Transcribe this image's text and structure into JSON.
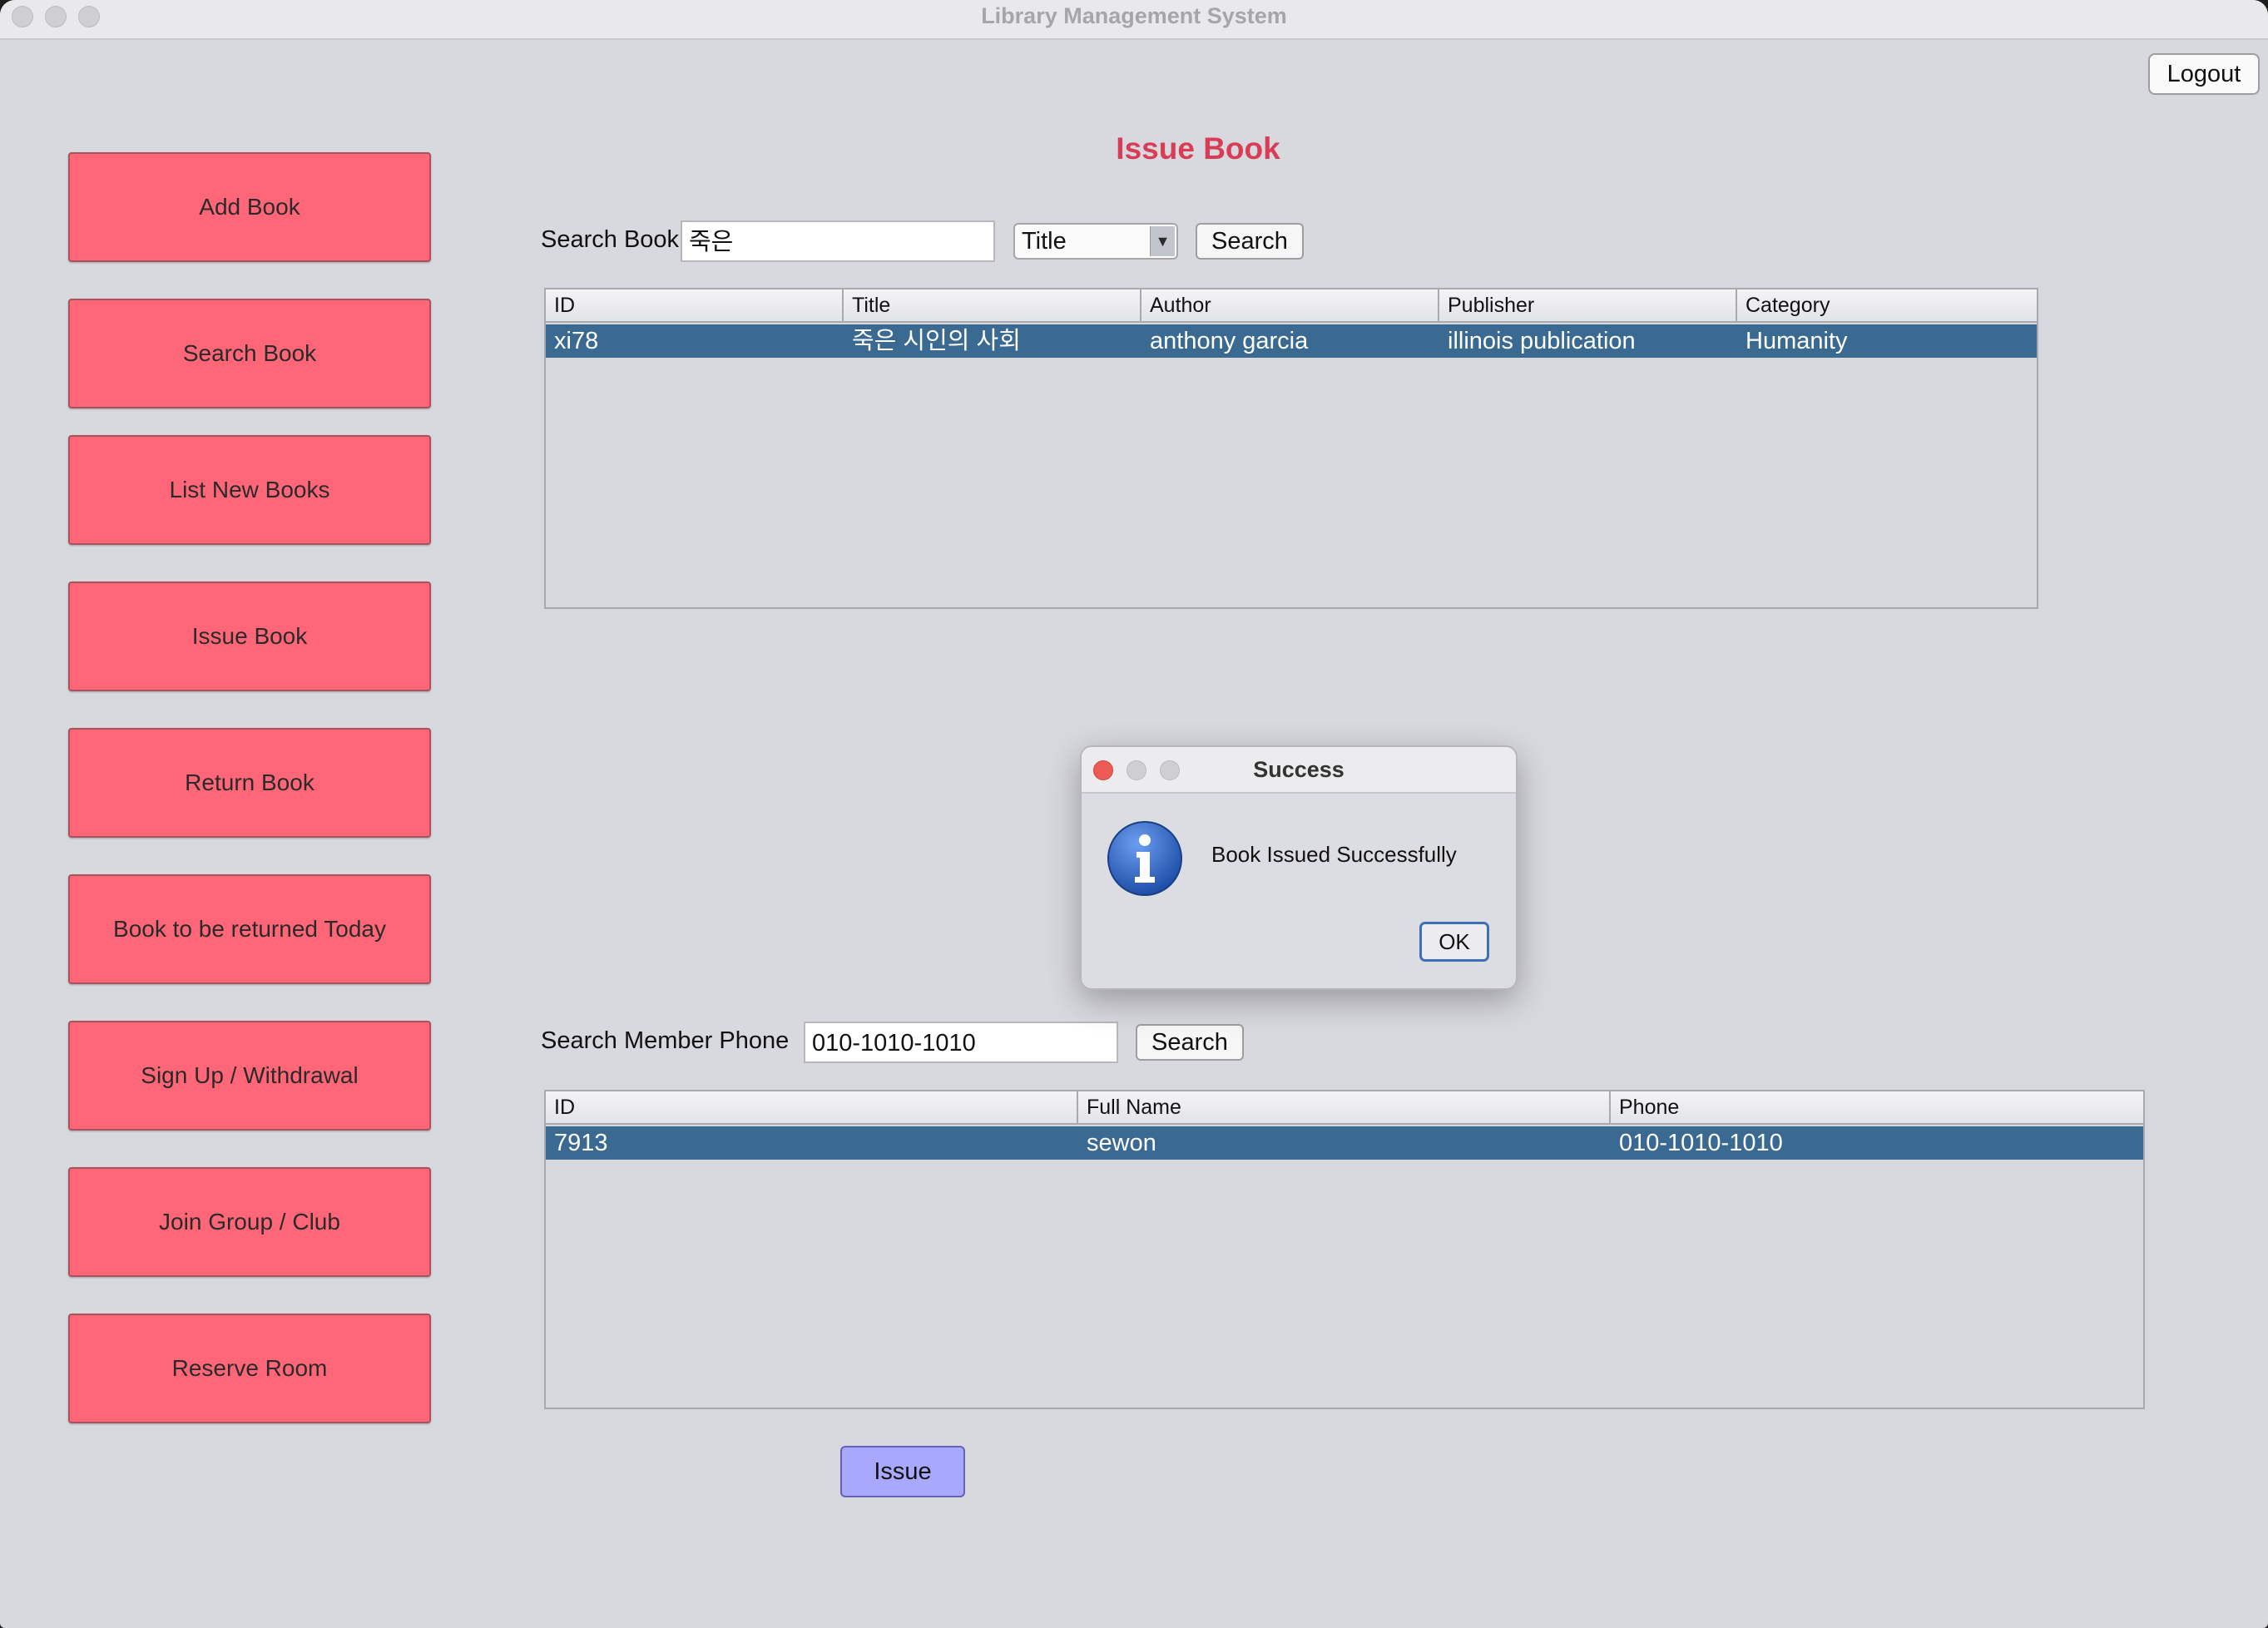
{
  "window": {
    "title": "Library Management System"
  },
  "header": {
    "logout_label": "Logout"
  },
  "sidebar": {
    "items": [
      {
        "label": "Add Book"
      },
      {
        "label": "Search Book"
      },
      {
        "label": "List New Books"
      },
      {
        "label": "Issue Book"
      },
      {
        "label": "Return Book"
      },
      {
        "label": "Book to be returned Today"
      },
      {
        "label": "Sign Up / Withdrawal"
      },
      {
        "label": "Join Group / Club"
      },
      {
        "label": "Reserve Room"
      }
    ]
  },
  "main": {
    "title": "Issue Book",
    "book_search": {
      "label": "Search Book",
      "value": "죽은",
      "filter_selected": "Title",
      "button_label": "Search"
    },
    "book_table": {
      "columns": [
        "ID",
        "Title",
        "Author",
        "Publisher",
        "Category"
      ],
      "rows": [
        [
          "xi78",
          "죽은 시인의 사회",
          "anthony garcia",
          "illinois publication",
          "Humanity"
        ]
      ]
    },
    "member_search": {
      "label": "Search Member Phone",
      "value": "010-1010-1010",
      "button_label": "Search"
    },
    "member_table": {
      "columns": [
        "ID",
        "Full Name",
        "Phone"
      ],
      "rows": [
        [
          "7913",
          "sewon",
          "010-1010-1010"
        ]
      ]
    },
    "issue_label": "Issue"
  },
  "dialog": {
    "title": "Success",
    "message": "Book Issued Successfully",
    "ok_label": "OK",
    "icon": "info-icon"
  },
  "colors": {
    "sidebar_button": "#ff6677",
    "title_accent": "#d93d55",
    "selected_row": "#3a6a91",
    "issue_button": "#a9a8ff"
  }
}
